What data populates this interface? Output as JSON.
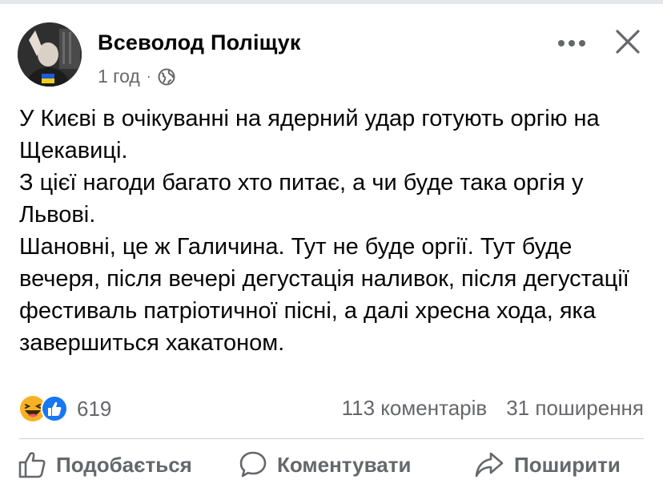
{
  "post": {
    "author": "Всеволод Поліщук",
    "time": "1 год",
    "separator": "·",
    "paragraphs": [
      "У Києві в очікуванні на ядерний удар готують оргію на Щекавиці.",
      "З цієї нагоди багато хто питає, а чи буде така оргія у Львові.",
      "Шановні, це ж Галичина. Тут не буде оргії. Тут буде вечеря, після вечері дегустація наливок, після дегустації фестиваль патріотичної пісні, а далі хресна хода, яка завершиться хакатоном."
    ]
  },
  "stats": {
    "reactions_count": "619",
    "comments": "113 коментарів",
    "shares": "31 поширення"
  },
  "actions": {
    "like": "Подобається",
    "comment": "Коментувати",
    "share": "Поширити"
  },
  "icons": {
    "more": "more-horizontal-icon",
    "close": "close-icon",
    "privacy": "globe-icon",
    "reaction_1": "haha-reaction-icon",
    "reaction_2": "like-reaction-icon"
  },
  "colors": {
    "text": "#050505",
    "secondary": "#65676b",
    "like_blue": "#1877f2",
    "haha_yellow": "#f7b125"
  }
}
